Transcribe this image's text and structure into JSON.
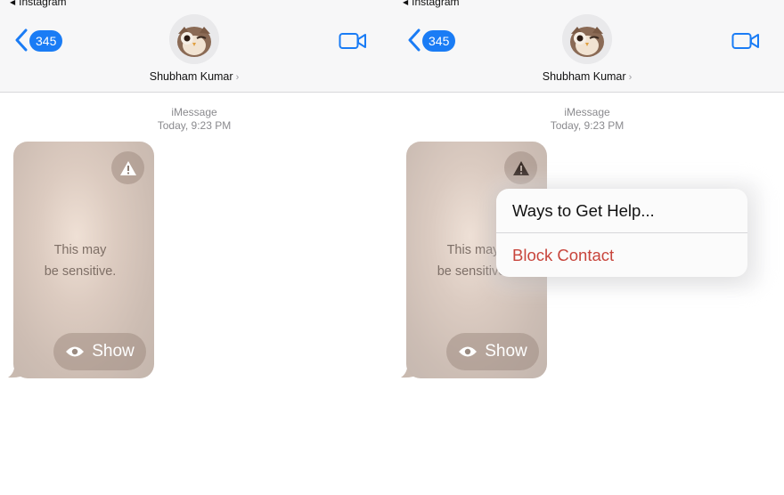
{
  "status_bar": {
    "back_app_label": "Instagram"
  },
  "header": {
    "unread_count": "345",
    "contact_name": "Shubham Kumar",
    "contact_chevron": "›"
  },
  "conversation": {
    "service_label": "iMessage",
    "timestamp": "Today, 9:23 PM",
    "sensitive_text_line1": "This may",
    "sensitive_text_line2": "be sensitive.",
    "show_label": "Show"
  },
  "context_menu": {
    "items": [
      {
        "label": "Ways to Get Help..."
      },
      {
        "label": "Block Contact"
      }
    ]
  },
  "colors": {
    "accent": "#1a7cf5",
    "destructive": "#c8453c"
  },
  "icons": {
    "back": "chevron-left-icon",
    "video": "video-camera-icon",
    "warning": "warning-icon",
    "show": "eye-icon"
  }
}
